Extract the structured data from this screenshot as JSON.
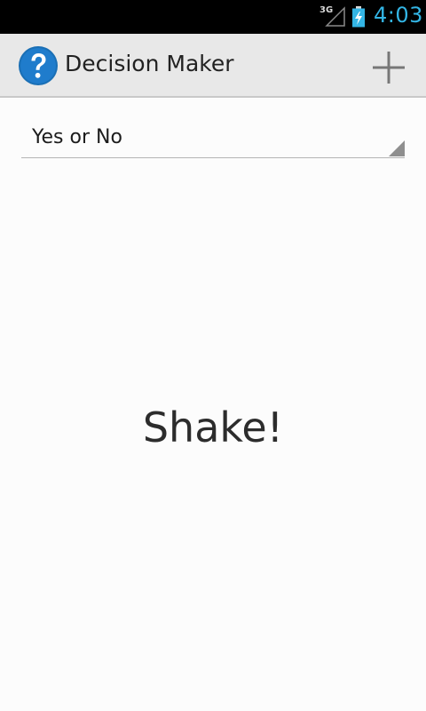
{
  "status_bar": {
    "network": "3G",
    "time": "4:03",
    "signal_icon": "signal-strength-icon",
    "battery_icon": "battery-charging-icon",
    "time_color": "#33b5e5"
  },
  "action_bar": {
    "app_icon": "question-mark-icon",
    "title": "Decision Maker",
    "add_icon": "plus-icon",
    "accent_color": "#1a6fb5"
  },
  "spinner": {
    "selected_value": "Yes or No",
    "arrow_icon": "spinner-arrow-icon"
  },
  "main": {
    "message": "Shake!"
  }
}
